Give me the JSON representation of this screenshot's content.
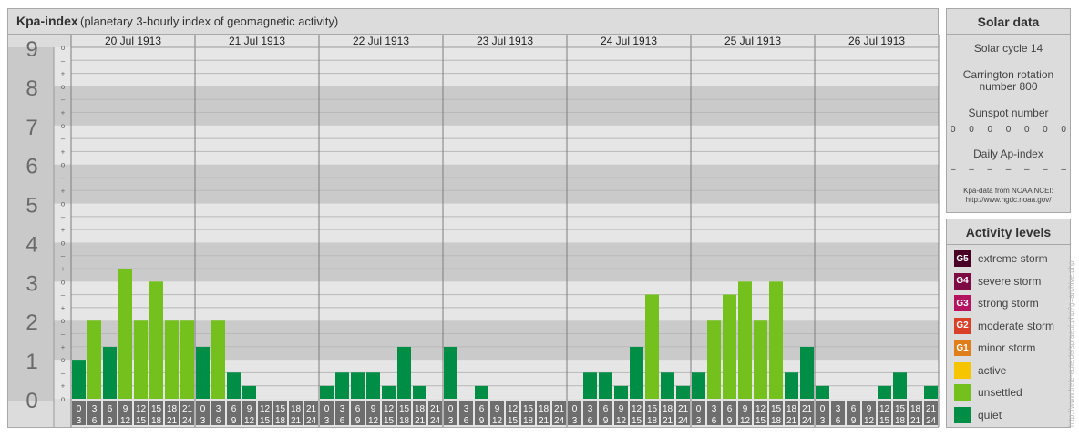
{
  "header": {
    "title": "Kpa-index",
    "subtitle": "(planetary 3-hourly index of geomagnetic activity)"
  },
  "chart_data": {
    "type": "bar",
    "ylim": [
      0,
      9
    ],
    "y_major_ticks": [
      "0",
      "1",
      "2",
      "3",
      "4",
      "5",
      "6",
      "7",
      "8",
      "9"
    ],
    "y_minor_ticks": [
      "o",
      "+",
      "–"
    ],
    "days": [
      "20 Jul 1913",
      "21 Jul 1913",
      "22 Jul 1913",
      "23 Jul 1913",
      "24 Jul 1913",
      "25 Jul 1913",
      "26 Jul 1913"
    ],
    "interval_start": [
      "0",
      "3",
      "6",
      "9",
      "12",
      "15",
      "18",
      "21"
    ],
    "interval_end": [
      "3",
      "6",
      "9",
      "12",
      "15",
      "18",
      "21",
      "24"
    ],
    "values": [
      1.0,
      2.0,
      1.33,
      3.33,
      2.0,
      3.0,
      2.0,
      2.0,
      1.33,
      2.0,
      0.67,
      0.33,
      0,
      0,
      0,
      0,
      0.33,
      0.67,
      0.67,
      0.67,
      0.33,
      1.33,
      0.33,
      0,
      1.33,
      0,
      0.33,
      0,
      0,
      0,
      0,
      0,
      0,
      0.67,
      0.67,
      0.33,
      1.33,
      2.67,
      0.67,
      0.33,
      0.67,
      2.0,
      2.67,
      3.0,
      2.0,
      3.0,
      0.67,
      1.33,
      0.33,
      0,
      0,
      0,
      0.33,
      0.67,
      0,
      0.33
    ],
    "colors": {
      "quiet": "#008d46",
      "unsettled": "#74c11d",
      "band_dark": "#cacaca",
      "band_light": "#e6e6e6"
    }
  },
  "solar": {
    "title": "Solar data",
    "cycle": "Solar cycle 14",
    "carrington_line1": "Carrington rotation",
    "carrington_line2": "number 800",
    "sunspot_label": "Sunspot number",
    "sunspot_values": [
      "0",
      "0",
      "0",
      "0",
      "0",
      "0",
      "0"
    ],
    "ap_label": "Daily Ap-index",
    "ap_values": [
      "–",
      "–",
      "–",
      "–",
      "–",
      "–",
      "–"
    ],
    "source_line1": "Kpa-data from NOAA NCEI:",
    "source_line2": "http://www.ngdc.noaa.gov/"
  },
  "activity": {
    "title": "Activity levels",
    "levels": [
      {
        "code": "G5",
        "label": "extreme storm",
        "color": "#4a0024"
      },
      {
        "code": "G4",
        "label": "severe storm",
        "color": "#7e0a44"
      },
      {
        "code": "G3",
        "label": "strong storm",
        "color": "#b3135f"
      },
      {
        "code": "G2",
        "label": "moderate storm",
        "color": "#d8402a"
      },
      {
        "code": "G1",
        "label": "minor storm",
        "color": "#e07e1c"
      },
      {
        "code": "",
        "label": "active",
        "color": "#f6c500"
      },
      {
        "code": "",
        "label": "unsettled",
        "color": "#74c11d"
      },
      {
        "code": "",
        "label": "quiet",
        "color": "#008d46"
      }
    ]
  },
  "watermark": "http://www.freie-eule.de/spraeul.php?g=archive.php"
}
